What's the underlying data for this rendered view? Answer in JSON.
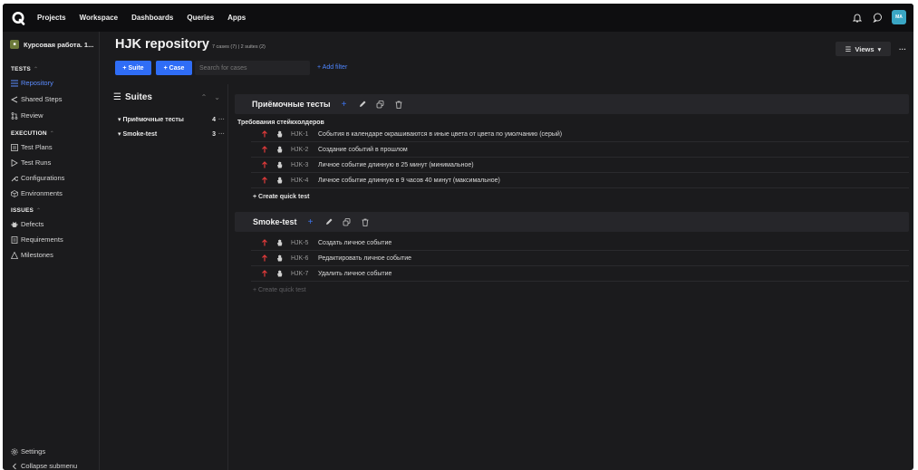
{
  "topbar": {
    "nav": [
      "Projects",
      "Workspace",
      "Dashboards",
      "Queries",
      "Apps"
    ],
    "avatar_initials": "MA",
    "avatar_color": "#3aa6c4"
  },
  "sidebar": {
    "project_name": "Курсовая работа. 1...",
    "tests_title": "TESTS",
    "tests_items": [
      {
        "label": "Repository",
        "icon": "list-icon",
        "active": true
      },
      {
        "label": "Shared Steps",
        "icon": "share-icon",
        "active": false
      },
      {
        "label": "Review",
        "icon": "merge-icon",
        "active": false
      }
    ],
    "execution_title": "EXECUTION",
    "execution_items": [
      {
        "label": "Test Plans",
        "icon": "plan-icon"
      },
      {
        "label": "Test Runs",
        "icon": "play-icon"
      },
      {
        "label": "Configurations",
        "icon": "wrench-icon"
      },
      {
        "label": "Environments",
        "icon": "cube-icon"
      }
    ],
    "issues_title": "ISSUES",
    "issues_items": [
      {
        "label": "Defects",
        "icon": "bug-icon"
      },
      {
        "label": "Requirements",
        "icon": "document-icon"
      },
      {
        "label": "Milestones",
        "icon": "milestone-icon"
      }
    ],
    "settings_label": "Settings",
    "collapse_label": "Collapse submenu"
  },
  "header": {
    "title": "HJK repository",
    "subtitle": "7 cases (7) | 2 suites (2)",
    "suite_button": "+ Suite",
    "case_button": "+ Case",
    "search_placeholder": "Search for cases",
    "add_filter": "+ Add filter",
    "views_label": "Views",
    "more_label": "···"
  },
  "suites_panel": {
    "title": "Suites",
    "items": [
      {
        "name": "Приёмочные тесты",
        "count": "4"
      },
      {
        "name": "Smoke-test",
        "count": "3"
      }
    ]
  },
  "suites": [
    {
      "title": "Приёмочные тесты",
      "description": "Требования стейкхолдеров",
      "quick_test": "+ Create quick test",
      "cases": [
        {
          "id": "HJK-1",
          "title": "События в календаре окрашиваются в иные цвета от цвета по умолчанию (серый)"
        },
        {
          "id": "HJK-2",
          "title": "Создание событий в прошлом"
        },
        {
          "id": "HJK-3",
          "title": "Личное событие длинную в 25 минут (минимальное)"
        },
        {
          "id": "HJK-4",
          "title": "Личное событие длинную в 9 часов 40 минут (максимальное)"
        }
      ]
    },
    {
      "title": "Smoke-test",
      "description": "",
      "quick_test": "+ Create quick test",
      "cases": [
        {
          "id": "HJK-5",
          "title": "Создать личное событие"
        },
        {
          "id": "HJK-6",
          "title": "Редактировать личное событие"
        },
        {
          "id": "HJK-7",
          "title": "Удалить личное событие"
        }
      ]
    }
  ],
  "colors": {
    "accent": "#2f6df6",
    "priority_high": "#e03a3a",
    "background": "#1b1b1d",
    "topbar": "#0e0e10"
  }
}
